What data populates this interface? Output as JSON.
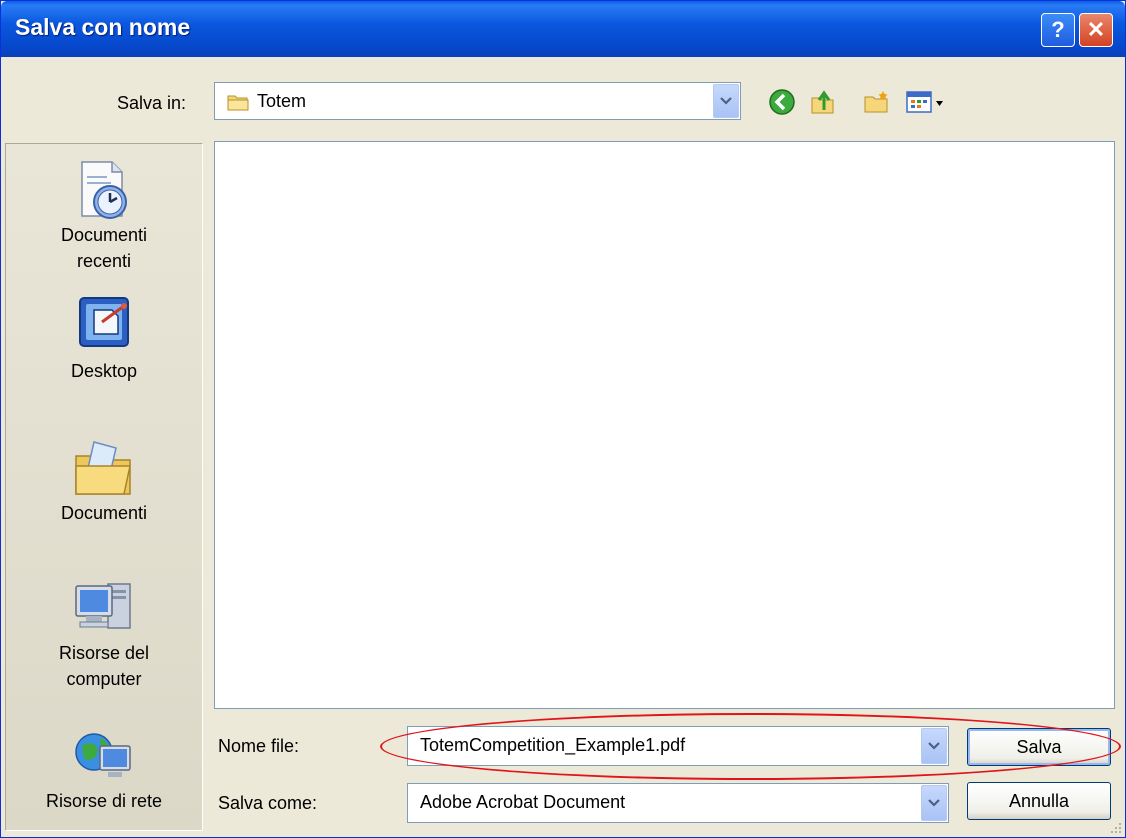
{
  "window": {
    "title": "Salva con nome",
    "help_label": "?",
    "close_label": "✕"
  },
  "save_in": {
    "label": "Salva in:",
    "value": "Totem"
  },
  "places": [
    {
      "label_line1": "Documenti",
      "label_line2": "recenti",
      "icon": "recent-documents-icon"
    },
    {
      "label_line1": "Desktop",
      "label_line2": "",
      "icon": "desktop-icon"
    },
    {
      "label_line1": "Documenti",
      "label_line2": "",
      "icon": "my-documents-icon"
    },
    {
      "label_line1": "Risorse del",
      "label_line2": "computer",
      "icon": "my-computer-icon"
    },
    {
      "label_line1": "Risorse di rete",
      "label_line2": "",
      "icon": "network-icon"
    }
  ],
  "file_name": {
    "label": "Nome file:",
    "value": "TotemCompetition_Example1.pdf"
  },
  "save_as_type": {
    "label": "Salva come:",
    "value": "Adobe Acrobat Document"
  },
  "buttons": {
    "save": "Salva",
    "cancel": "Annulla"
  },
  "colors": {
    "titlebar": "#0A58E0",
    "highlight": "#E0141B",
    "dialog_bg": "#ECE9D8"
  }
}
